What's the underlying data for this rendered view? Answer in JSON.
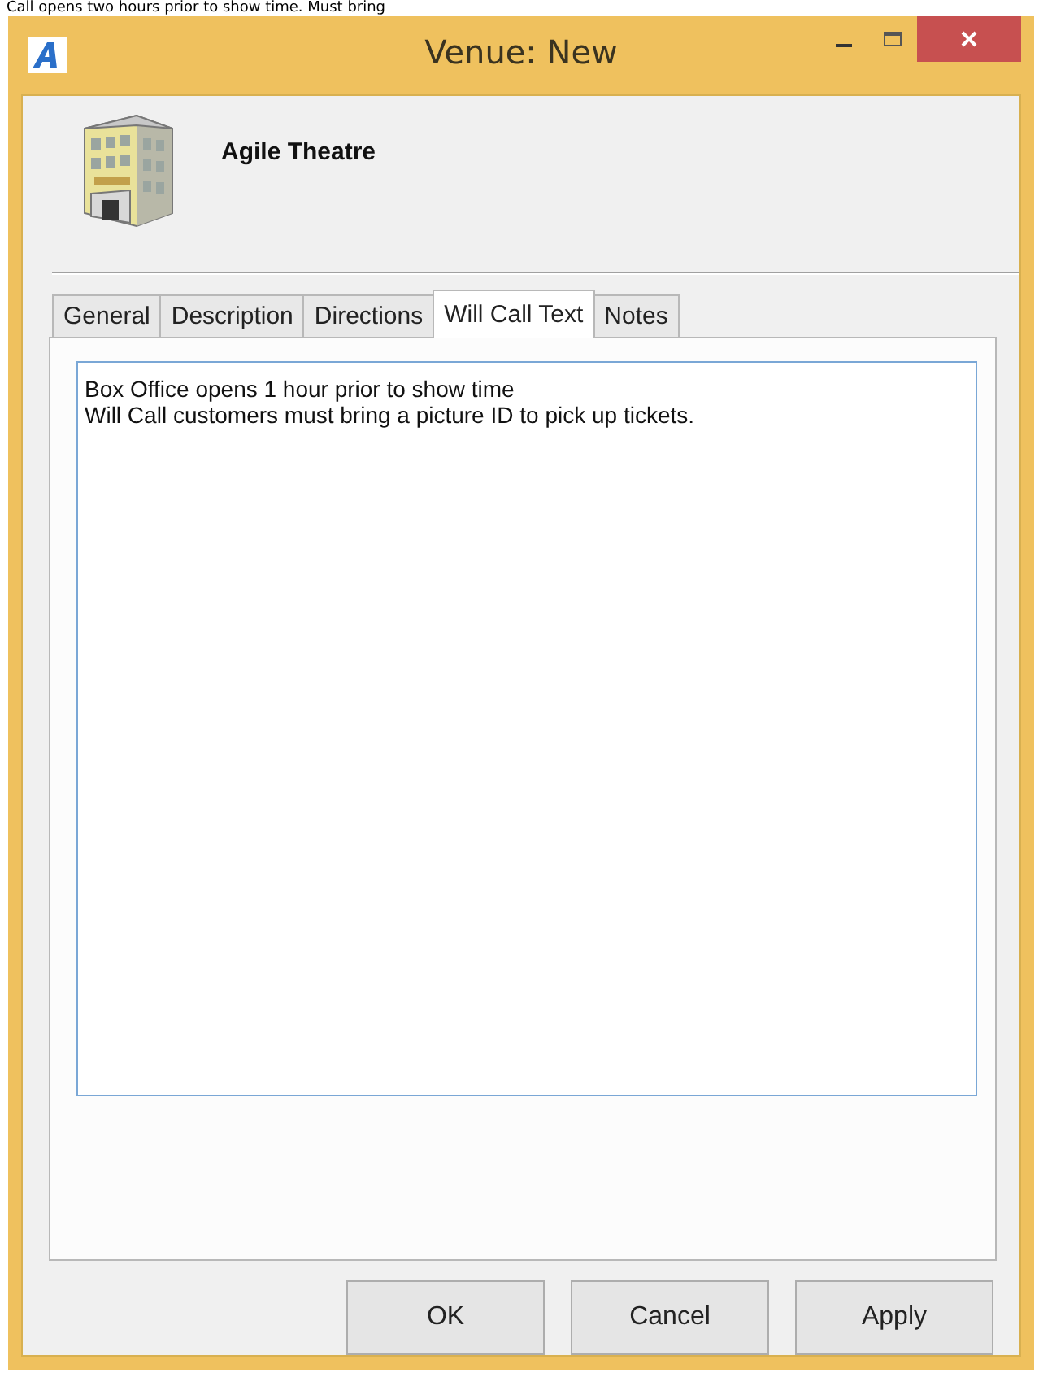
{
  "background_text": "Call opens two hours prior to show time. Must bring",
  "window": {
    "title": "Venue: New"
  },
  "header": {
    "name": "Agile Theatre"
  },
  "tabs": [
    {
      "label": "General",
      "selected": false
    },
    {
      "label": "Description",
      "selected": false
    },
    {
      "label": "Directions",
      "selected": false
    },
    {
      "label": "Will Call Text",
      "selected": true
    },
    {
      "label": "Notes",
      "selected": false
    }
  ],
  "will_call_text": {
    "value": "Box Office opens 1 hour prior to show time\nWill Call customers must bring a picture ID to pick up tickets."
  },
  "buttons": [
    "OK",
    "Cancel",
    "Apply"
  ]
}
